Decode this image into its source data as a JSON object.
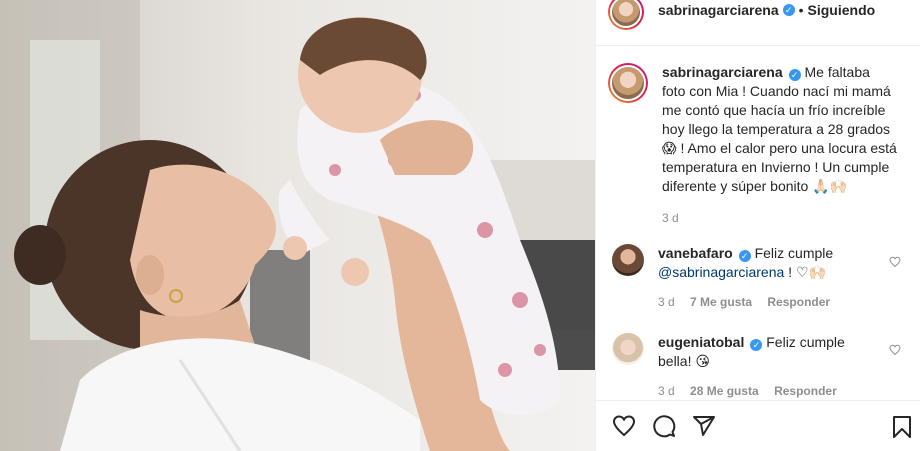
{
  "post": {
    "author": "sabrinagarciarena",
    "follow_label": "Siguiendo",
    "separator": "•",
    "verified_mark": "✓"
  },
  "caption": {
    "username": "sabrinagarciarena",
    "text": "Me faltaba foto con Mia ! Cuando nací mi mamá me contó que hacía un frío increíble hoy llego la temperatura a 28 grados 😱 ! Amo el calor pero una locura está temperatura en Invierno ! Un cumple diferente y súper bonito 🙏🏻🙌🏻",
    "time": "3 d"
  },
  "comments": [
    {
      "username": "vanebafaro",
      "text_before": "Feliz cumple ",
      "mention": "@sabrinagarciarena",
      "text_after": " ! ♡🙌🏻",
      "time": "3 d",
      "likes": "7 Me gusta",
      "reply": "Responder"
    },
    {
      "username": "eugeniatobal",
      "text_before": "Feliz cumple bella! 😘",
      "mention": "",
      "text_after": "",
      "time": "3 d",
      "likes": "28 Me gusta",
      "reply": "Responder"
    }
  ],
  "icons": {
    "like": "heart-icon",
    "comment": "comment-icon",
    "share": "share-icon",
    "save": "bookmark-icon"
  },
  "colors": {
    "verified": "#3897f0",
    "muted": "#8e8e8e",
    "mention": "#00376b",
    "story_ring": "#dc2743"
  }
}
